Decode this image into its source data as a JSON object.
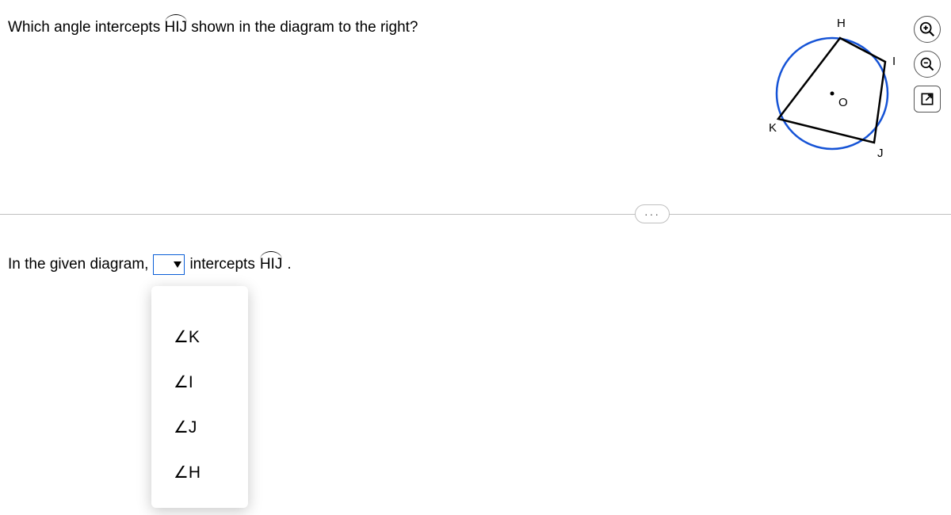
{
  "question": {
    "prefix": "Which angle intercepts ",
    "arc_text": "HIJ",
    "suffix": " shown in the diagram to the right?"
  },
  "diagram": {
    "labels": {
      "H": "H",
      "I": "I",
      "J": "J",
      "K": "K",
      "O": "O"
    }
  },
  "tools": {
    "zoom_in": "zoom-in",
    "zoom_out": "zoom-out",
    "open": "open-new"
  },
  "divider": {
    "more": "···"
  },
  "answer": {
    "prefix": "In the given diagram,",
    "mid": " intercepts ",
    "arc_text": "HIJ",
    "suffix": "."
  },
  "options": [
    "∠K",
    "∠I",
    "∠J",
    "∠H"
  ]
}
